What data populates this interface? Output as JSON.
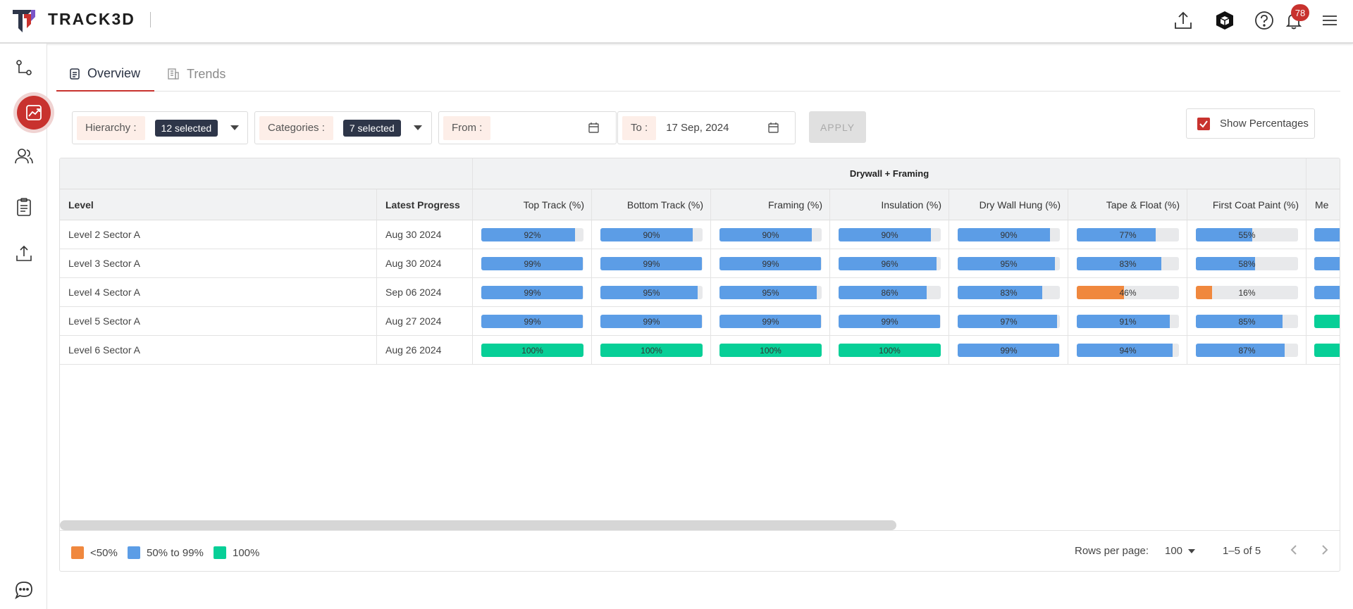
{
  "header": {
    "brand": "TRACK3D",
    "notification_count": "78",
    "icons": [
      "upload-icon",
      "cube-icon",
      "help-icon",
      "bell-icon",
      "menu-icon"
    ]
  },
  "sidebar": {
    "items": [
      "process-icon",
      "analytics-icon",
      "users-icon",
      "clipboard-icon",
      "upload-icon",
      "chat-icon"
    ],
    "active": "analytics-icon"
  },
  "tabs": [
    {
      "label": "Overview",
      "active": true
    },
    {
      "label": "Trends",
      "active": false
    }
  ],
  "filters": {
    "hierarchy_label": "Hierarchy :",
    "hierarchy_value": "12 selected",
    "categories_label": "Categories :",
    "categories_value": "7 selected",
    "from_label": "From :",
    "from_value": "",
    "to_label": "To :",
    "to_value": "17 Sep, 2024",
    "apply_label": "APPLY",
    "show_percentages_label": "Show Percentages",
    "show_percentages_checked": true
  },
  "table": {
    "group_header": "Drywall + Framing",
    "level_header": "Level",
    "progress_header": "Latest Progress",
    "columns": [
      "Top Track (%)",
      "Bottom Track (%)",
      "Framing (%)",
      "Insulation (%)",
      "Dry Wall Hung (%)",
      "Tape & Float (%)",
      "First Coat Paint (%)",
      "Me"
    ],
    "rows": [
      {
        "level": "Level 2 Sector A",
        "date": "Aug 30 2024",
        "values": [
          "92%",
          "90%",
          "90%",
          "90%",
          "90%",
          "77%",
          "55%"
        ],
        "last_status": "mid"
      },
      {
        "level": "Level 3 Sector A",
        "date": "Aug 30 2024",
        "values": [
          "99%",
          "99%",
          "99%",
          "96%",
          "95%",
          "83%",
          "58%"
        ],
        "last_status": "mid"
      },
      {
        "level": "Level 4 Sector A",
        "date": "Sep 06 2024",
        "values": [
          "99%",
          "95%",
          "95%",
          "86%",
          "83%",
          "46%",
          "16%"
        ],
        "last_status": "mid"
      },
      {
        "level": "Level 5 Sector A",
        "date": "Aug 27 2024",
        "values": [
          "99%",
          "99%",
          "99%",
          "99%",
          "97%",
          "91%",
          "85%"
        ],
        "last_status": "full"
      },
      {
        "level": "Level 6 Sector A",
        "date": "Aug 26 2024",
        "values": [
          "100%",
          "100%",
          "100%",
          "100%",
          "99%",
          "94%",
          "87%"
        ],
        "last_status": "full"
      }
    ]
  },
  "legend": [
    {
      "label": "<50%",
      "color": "#f0883e"
    },
    {
      "label": "50% to 99%",
      "color": "#5c9de6"
    },
    {
      "label": "100%",
      "color": "#07cf97"
    }
  ],
  "pagination": {
    "rows_per_page_label": "Rows per page:",
    "rows_per_page_value": "100",
    "range": "1–5 of 5"
  }
}
